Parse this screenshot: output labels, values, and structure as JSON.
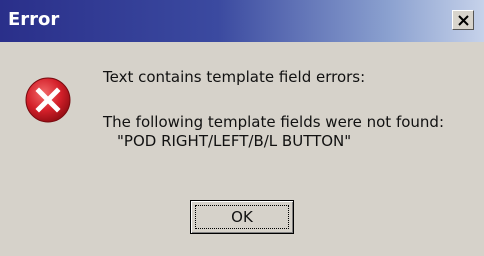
{
  "window": {
    "title": "Error",
    "close_icon": "close-icon"
  },
  "icon": {
    "name": "error-icon",
    "color": "#d4202a"
  },
  "message": {
    "line1": "Text contains template field errors:",
    "line2": "The following template fields were not found:",
    "line3": "\"POD RIGHT/LEFT/B/L BUTTON\""
  },
  "buttons": {
    "ok_label": "OK"
  },
  "colors": {
    "titlebar_start": "#2a2f8a",
    "titlebar_end": "#c6d2ea",
    "dialog_background": "#d6d2ca"
  }
}
